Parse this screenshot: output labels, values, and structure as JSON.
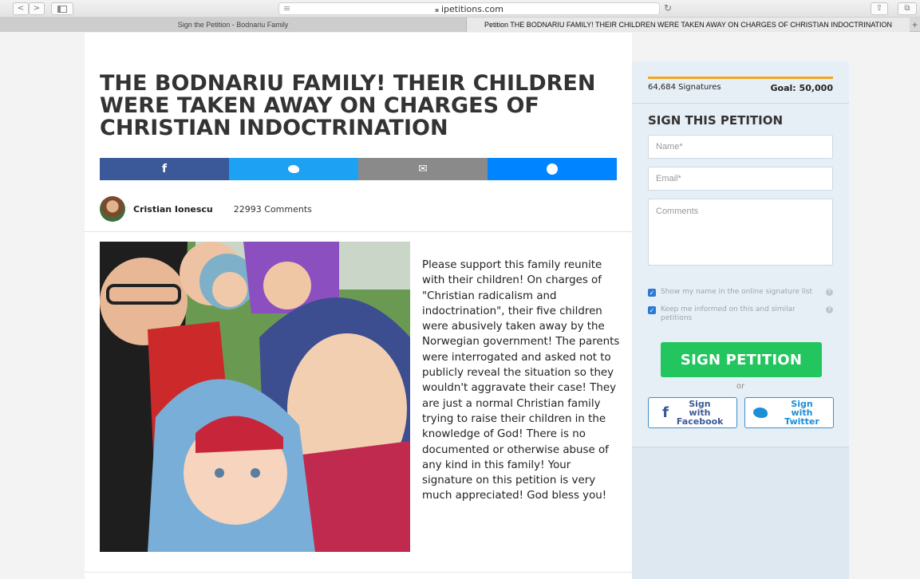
{
  "browser": {
    "url": "ipetitions.com",
    "tabs": [
      {
        "label": "Sign the Petition - Bodnariu Family"
      },
      {
        "label": "Petition THE BODNARIU FAMILY! THEIR CHILDREN WERE TAKEN AWAY ON CHARGES OF CHRISTIAN INDOCTRINATION"
      }
    ],
    "new_tab": "+",
    "back": "<",
    "forward": ">",
    "reader": "≡",
    "reload": "↻",
    "share": "⇧",
    "tabs_overview": "⧉"
  },
  "petition": {
    "title": "THE BODNARIU FAMILY! THEIR CHILDREN WERE TAKEN AWAY ON CHARGES OF CHRISTIAN INDOCTRINATION",
    "share_buttons": [
      {
        "icon": "facebook-icon",
        "glyph": "f",
        "color": "#3b5998"
      },
      {
        "icon": "twitter-icon",
        "glyph": "🐦",
        "color": "#1da1f2"
      },
      {
        "icon": "email-icon",
        "glyph": "✉",
        "color": "#8a8a8a"
      },
      {
        "icon": "messenger-icon",
        "glyph": "●",
        "color": "#0084ff"
      }
    ],
    "author": "Cristian Ionescu",
    "comments": "22993 Comments",
    "body": "Please support this family reunite with their children! On charges of \"Christian radicalism and indoctrination\", their five children were abusively taken away by the Norwegian government! The parents were interrogated and asked not to publicly reveal the situation so they wouldn't aggravate their case! They are just a normal Christian family trying to raise their children in the knowledge of God! There is no documented or otherwise abuse of any kind in this family! Your signature on this petition is very much appreciated! God bless you!"
  },
  "sidebar": {
    "signatures": "64,684 Signatures",
    "goal": "Goal: 50,000",
    "progress_fraction": 1.0,
    "heading": "SIGN THIS PETITION",
    "name_placeholder": "Name*",
    "email_placeholder": "Email*",
    "comments_placeholder": "Comments",
    "checkbox_show_name": "Show my name in the online signature list",
    "checkbox_keep_informed": "Keep me informed on this and similar petitions",
    "sign_button": "SIGN PETITION",
    "or": "or",
    "facebook_button": "Sign with Facebook",
    "twitter_button": "Sign with Twitter"
  },
  "colors": {
    "sign_green": "#22c55e",
    "progress": "#f4a623",
    "facebook": "#3b5998",
    "twitter": "#1da1f2"
  }
}
